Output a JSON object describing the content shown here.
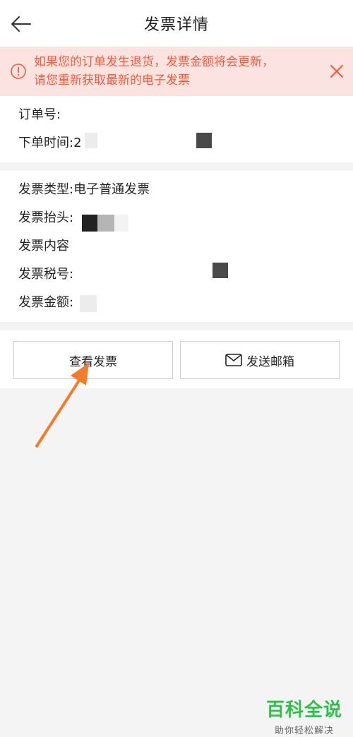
{
  "header": {
    "title": "发票详情"
  },
  "notice": {
    "line1": "如果您的订单发生退货，发票金额将会更新，",
    "line2": "请您重新获取最新的电子发票"
  },
  "order": {
    "order_no_label": "订单号:",
    "order_time_label": "下单时间:",
    "order_time_value": "2"
  },
  "invoice": {
    "type_label": "发票类型:",
    "type_value": "电子普通发票",
    "header_label": "发票抬头:",
    "content_label": "发票内容",
    "tax_label": "发票税号:",
    "amount_label": "发票金额:"
  },
  "actions": {
    "view_label": "查看发票",
    "mail_label": "发送邮箱"
  },
  "watermark": {
    "main": "百科全说",
    "sub": "助你轻松解决"
  },
  "colors": {
    "notice_bg": "#fbe3df",
    "notice_text": "#ef5a3d",
    "arrow": "#f37b2c",
    "watermark": "#2fbf4b"
  },
  "icons": [
    "back-arrow-icon",
    "info-icon",
    "close-icon",
    "mail-icon",
    "pointer-arrow-icon"
  ]
}
